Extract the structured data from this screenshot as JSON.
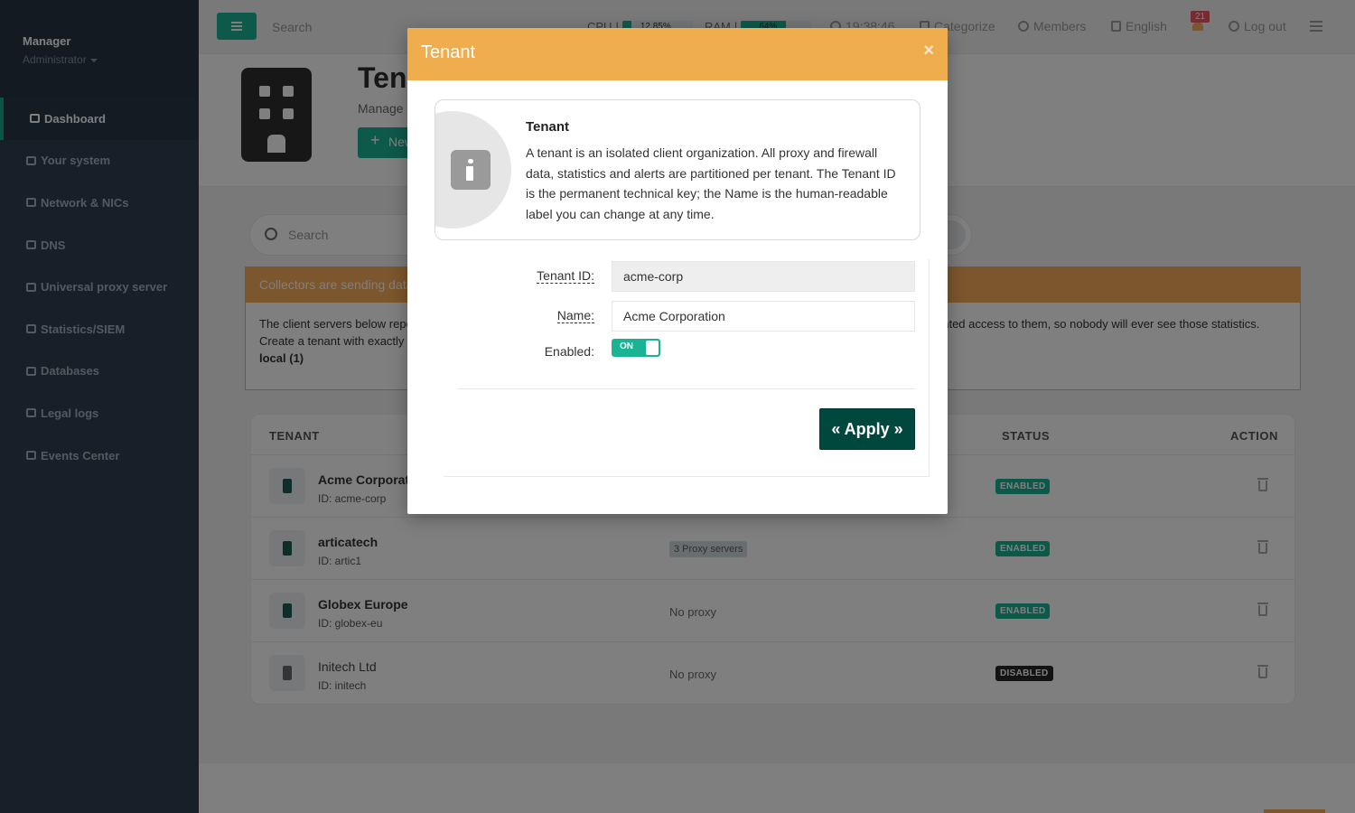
{
  "sidebar": {
    "user_name": "Manager",
    "user_role": "Administrator",
    "items": [
      {
        "label": "Dashboard",
        "icon": "dashboard-icon",
        "active": true
      },
      {
        "label": "Your system",
        "icon": "server-icon",
        "active": false
      },
      {
        "label": "Network & NICs",
        "icon": "sitemap-icon",
        "active": false
      },
      {
        "label": "DNS",
        "icon": "database-icon",
        "active": false
      },
      {
        "label": "Universal proxy server",
        "icon": "globe-icon",
        "active": false
      },
      {
        "label": "Statistics/SIEM",
        "icon": "chart-icon",
        "active": false
      },
      {
        "label": "Databases",
        "icon": "database-icon",
        "active": false
      },
      {
        "label": "Legal logs",
        "icon": "file-icon",
        "active": false
      },
      {
        "label": "Events Center",
        "icon": "file-icon",
        "active": false
      }
    ]
  },
  "topbar": {
    "search_placeholder": "Search",
    "cpu_label": "CPU",
    "cpu_value": "12.85%",
    "cpu_percent": 12.85,
    "ram_label": "RAM",
    "ram_value": "64%",
    "ram_percent": 64,
    "clock": "19:38:46",
    "categorize": "Categorize",
    "members": "Members",
    "language": "English",
    "notifications_count": "21",
    "logout": "Log out"
  },
  "page": {
    "title": "Tenants",
    "subtitle": "Manage tenants",
    "new_button": "New tenant"
  },
  "list_search": {
    "placeholder": "Search"
  },
  "alert": {
    "header": "Collectors are sending data using tenants that are not registered",
    "line1": "The client servers below report data under tenant IDs that do not exist. No administrator has been gr",
    "line1_right": "anted access to them, so nobody will ever see those statistics.",
    "line2": "Create a tenant with exactly the same ID to see these statistics.",
    "unknown_tenant": "local (1)"
  },
  "table": {
    "headers": {
      "tenant": "TENANT",
      "status": "STATUS",
      "action": "ACTION"
    },
    "rows": [
      {
        "name": "Acme Corporation",
        "id": "ID: acme-corp",
        "proxy": "",
        "status": "ENABLED",
        "enabled": true
      },
      {
        "name": "articatech",
        "id": "ID: artic1",
        "proxy_badge": "3 Proxy servers",
        "status": "ENABLED",
        "enabled": true
      },
      {
        "name": "Globex Europe",
        "id": "ID: globex-eu",
        "proxy": "No proxy",
        "status": "ENABLED",
        "enabled": true
      },
      {
        "name": "Initech Ltd",
        "id": "ID: initech",
        "proxy": "No proxy",
        "status": "DISABLED",
        "enabled": false
      }
    ]
  },
  "modal": {
    "title": "Tenant",
    "close": "×",
    "info_title": "Tenant",
    "info_text": "A tenant is an isolated client organization. All proxy and firewall data, statistics and alerts are partitioned per tenant. The Tenant ID is the permanent technical key; the Name is the human-readable label you can change at any time.",
    "tenant_id_label": "Tenant ID:",
    "tenant_id_value": "acme-corp",
    "name_label": "Name:",
    "name_value": "Acme Corporation",
    "enabled_label": "Enabled:",
    "toggle_on": "ON",
    "apply": "« Apply »"
  },
  "colors": {
    "sidebar_bg": "#2f4050",
    "accent": "#1ab394",
    "modal_header": "#f0ad4e",
    "apply_button": "#00483e",
    "alert": "#f8ac59"
  }
}
